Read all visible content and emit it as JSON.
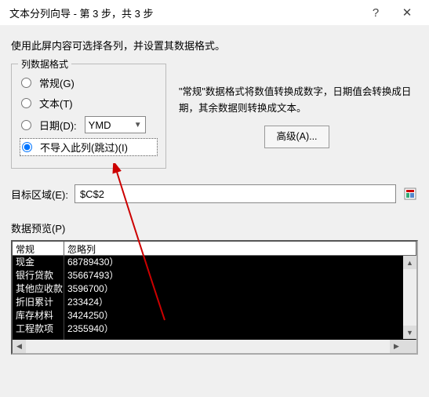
{
  "titlebar": {
    "title": "文本分列向导 - 第 3 步，共 3 步",
    "help_icon": "?",
    "close_icon": "✕"
  },
  "instruction": "使用此屏内容可选择各列，并设置其数据格式。",
  "format_group": {
    "legend": "列数据格式",
    "general": "常规(G)",
    "text": "文本(T)",
    "date": "日期(D):",
    "date_value": "YMD",
    "skip": "不导入此列(跳过)(I)"
  },
  "info_text": "\"常规\"数据格式将数值转换成数字，日期值会转换成日期，其余数据则转换成文本。",
  "advanced_btn": "高级(A)...",
  "target": {
    "label": "目标区域(E):",
    "value": "$C$2"
  },
  "preview": {
    "label": "数据预览(P)",
    "headers": [
      "常规",
      "忽略列"
    ],
    "col1": [
      "现金",
      "银行贷款",
      "其他应收款",
      "折旧累计",
      "库存材料",
      "工程款项"
    ],
    "col2": [
      "68789430）",
      "35667493）",
      "3596700）",
      "233424）",
      "3424250）",
      "2355940）"
    ]
  }
}
